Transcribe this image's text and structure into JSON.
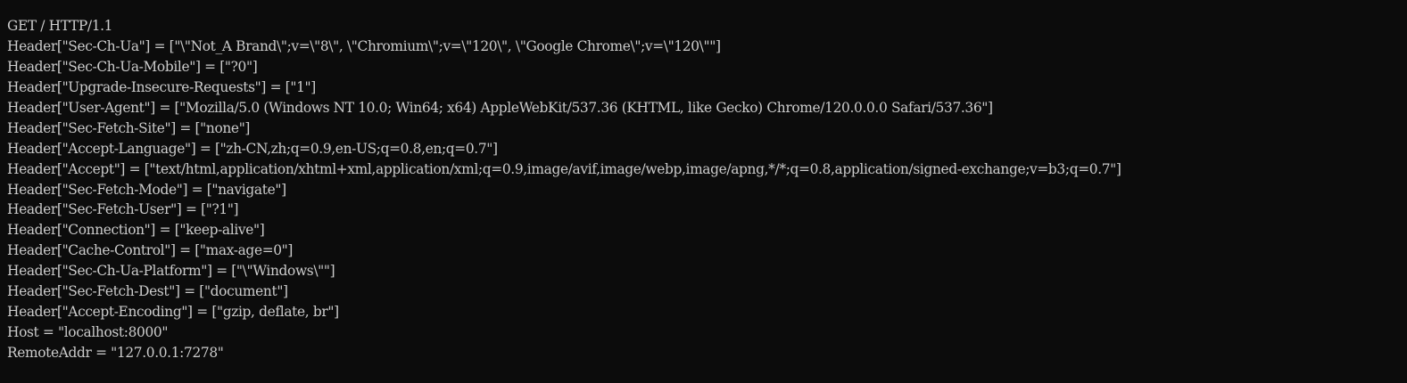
{
  "terminal": {
    "background": "#0c0c0c",
    "foreground": "#cccccc",
    "lines": [
      "GET / HTTP/1.1",
      "Header[\"Sec-Ch-Ua\"] = [\"\\\"Not_A Brand\\\";v=\\\"8\\\", \\\"Chromium\\\";v=\\\"120\\\", \\\"Google Chrome\\\";v=\\\"120\\\"\"]",
      "Header[\"Sec-Ch-Ua-Mobile\"] = [\"?0\"]",
      "Header[\"Upgrade-Insecure-Requests\"] = [\"1\"]",
      "Header[\"User-Agent\"] = [\"Mozilla/5.0 (Windows NT 10.0; Win64; x64) AppleWebKit/537.36 (KHTML, like Gecko) Chrome/120.0.0.0 Safari/537.36\"]",
      "Header[\"Sec-Fetch-Site\"] = [\"none\"]",
      "Header[\"Accept-Language\"] = [\"zh-CN,zh;q=0.9,en-US;q=0.8,en;q=0.7\"]",
      "Header[\"Accept\"] = [\"text/html,application/xhtml+xml,application/xml;q=0.9,image/avif,image/webp,image/apng,*/*;q=0.8,application/signed-exchange;v=b3;q=0.7\"]",
      "Header[\"Sec-Fetch-Mode\"] = [\"navigate\"]",
      "Header[\"Sec-Fetch-User\"] = [\"?1\"]",
      "Header[\"Connection\"] = [\"keep-alive\"]",
      "Header[\"Cache-Control\"] = [\"max-age=0\"]",
      "Header[\"Sec-Ch-Ua-Platform\"] = [\"\\\"Windows\\\"\"]",
      "Header[\"Sec-Fetch-Dest\"] = [\"document\"]",
      "Header[\"Accept-Encoding\"] = [\"gzip, deflate, br\"]",
      "Host = \"localhost:8000\"",
      "RemoteAddr = \"127.0.0.1:7278\""
    ]
  }
}
